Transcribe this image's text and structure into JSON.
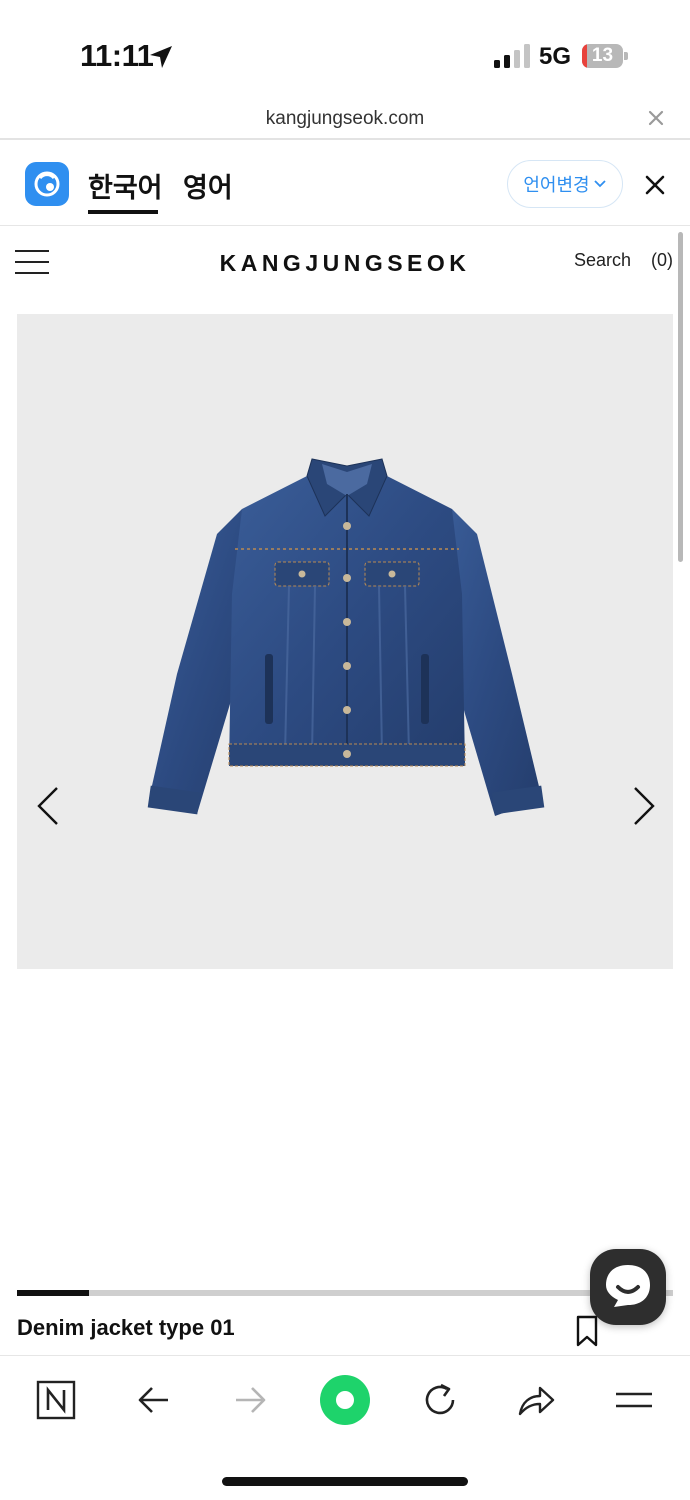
{
  "status_bar": {
    "time": "11:11",
    "network": "5G",
    "battery_level": "13",
    "battery_fraction": 0.13
  },
  "url_bar": {
    "domain": "kangjungseok.com"
  },
  "translate_bar": {
    "tabs": [
      {
        "label": "한국어",
        "active": true
      },
      {
        "label": "영어",
        "active": false
      }
    ],
    "change_language_label": "언어변경",
    "accent_color": "#2f8ff0"
  },
  "site_header": {
    "brand": "KANGJUNGSEOK",
    "search_label": "Search",
    "cart_count": "(0)"
  },
  "product": {
    "title": "Denim jacket type 01",
    "gallery_progress_fraction": 0.11,
    "image_icon": "denim-jacket"
  },
  "toolbar": {
    "items": [
      {
        "icon": "naver-n-icon"
      },
      {
        "icon": "back-arrow-icon"
      },
      {
        "icon": "forward-arrow-icon"
      },
      {
        "icon": "green-home-icon"
      },
      {
        "icon": "reload-icon"
      },
      {
        "icon": "share-icon"
      },
      {
        "icon": "menu-icon"
      }
    ]
  }
}
